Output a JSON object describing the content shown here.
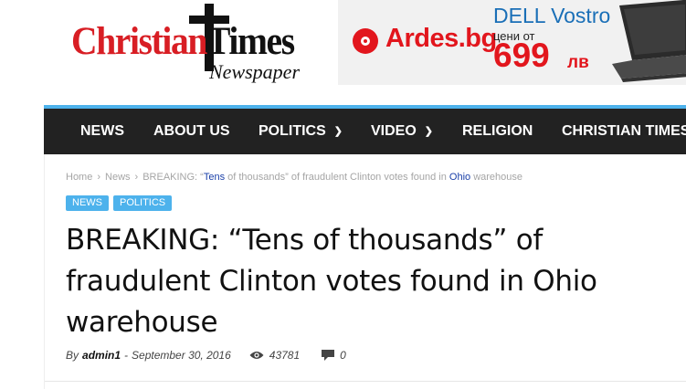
{
  "logo": {
    "part1": "Christian",
    "part2": "Times",
    "sub": "Newspaper"
  },
  "ad": {
    "brand": "Ardes.bg",
    "product": "DELL Vostro",
    "price_prefix": "цени от",
    "price": "699",
    "currency": "лв"
  },
  "nav": {
    "items": [
      {
        "label": "NEWS"
      },
      {
        "label": "ABOUT US"
      },
      {
        "label": "POLITICS",
        "dropdown": true
      },
      {
        "label": "VIDEO",
        "dropdown": true
      },
      {
        "label": "RELIGION"
      },
      {
        "label": "CHRISTIAN TIMES"
      }
    ],
    "accent": "#4db2ec",
    "background": "#222222"
  },
  "breadcrumb": {
    "home": "Home",
    "section": "News",
    "current_a": "BREAKING: “",
    "current_b": "Tens",
    "current_c": " of thousands” of fraudulent Clinton votes found in ",
    "current_d": "Ohio",
    "current_e": " warehouse"
  },
  "categories": [
    "NEWS",
    "POLITICS"
  ],
  "article": {
    "title": "BREAKING: “Tens of thousands” of fraudulent Clinton votes found in Ohio warehouse",
    "by": "By",
    "author": "admin1",
    "dash": "-",
    "date": "September 30, 2016",
    "views": "43781",
    "comments": "0"
  },
  "icons": {
    "views": "eye-icon",
    "comments": "comment-icon",
    "logo_cross": "cross-icon",
    "chevron": "chevron-down-icon"
  }
}
